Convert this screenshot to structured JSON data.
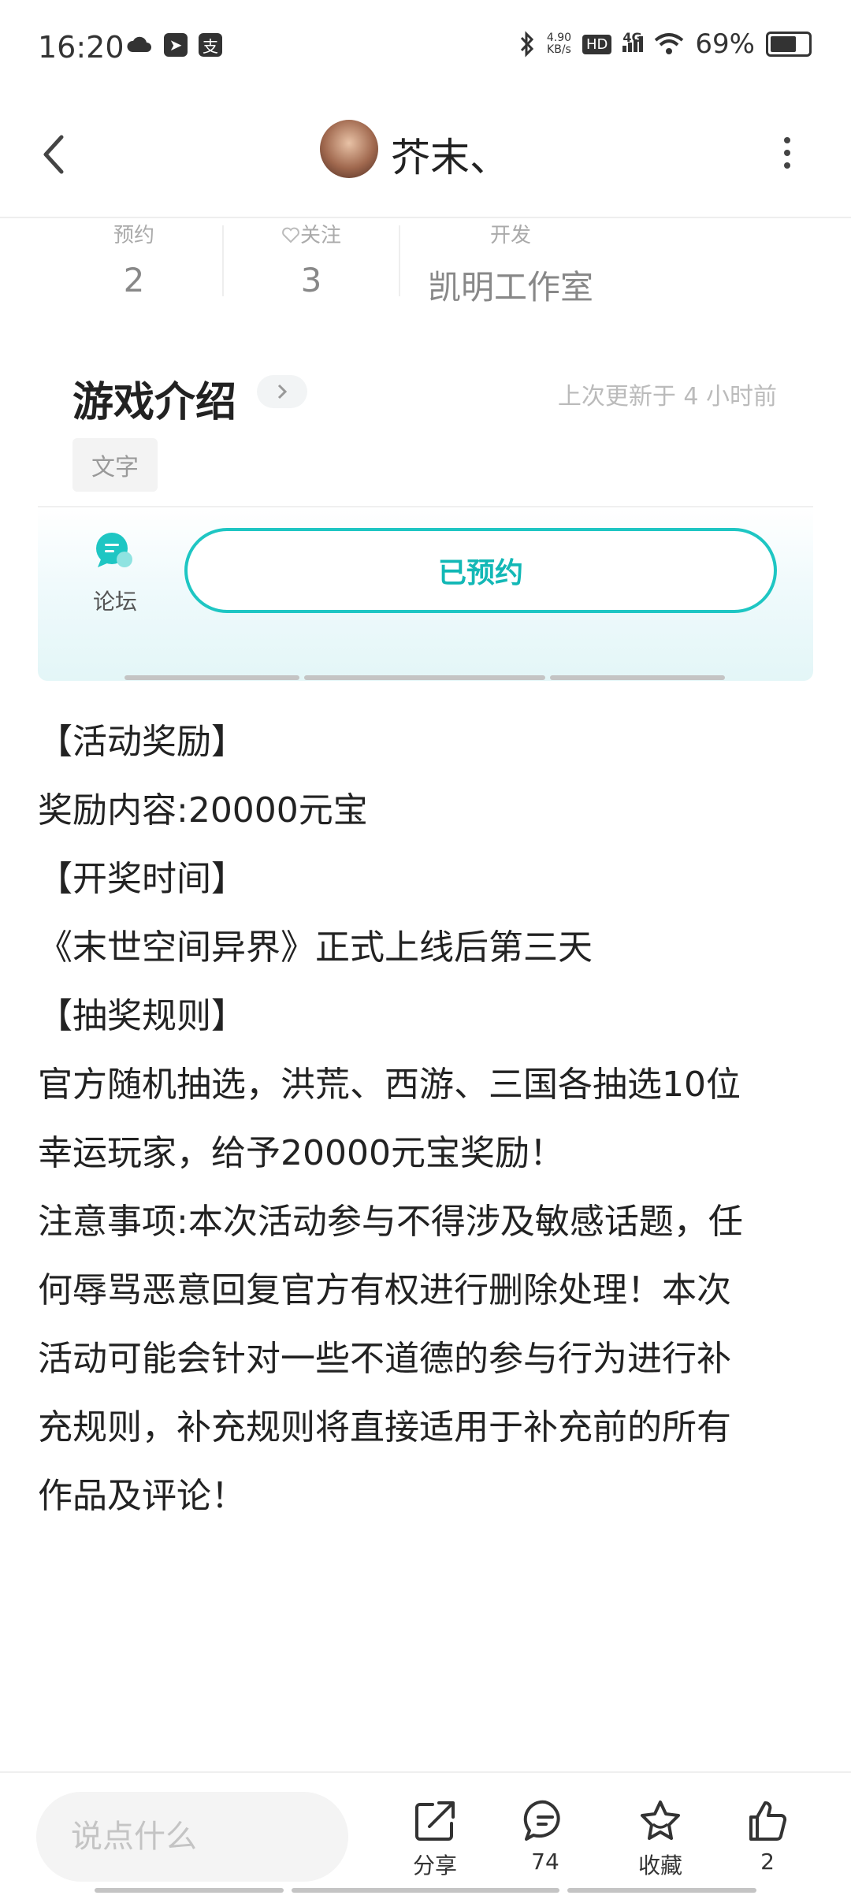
{
  "status_bar": {
    "time": "16:20",
    "net_speed_value": "4.90",
    "net_speed_unit": "KB/s",
    "hd": "HD",
    "network": "4G",
    "battery_text": "69%",
    "battery_level": 0.69
  },
  "header": {
    "nickname": "芥末、"
  },
  "stats": [
    {
      "label": "预约",
      "value": "2"
    },
    {
      "label": "关注",
      "value": "3"
    },
    {
      "label": "开发",
      "value": "凯明工作室"
    }
  ],
  "intro": {
    "title": "游戏介绍",
    "updated": "上次更新于 4 小时前",
    "tag": "文字"
  },
  "actions": {
    "forum_label": "论坛",
    "reserve_label": "已预约"
  },
  "article": [
    "【活动奖励】",
    "奖励内容:20000元宝",
    "",
    "【开奖时间】",
    "《末世空间异界》正式上线后第三天",
    "",
    "【抽奖规则】",
    "官方随机抽选，洪荒、西游、三国各抽选10位",
    "幸运玩家，给予20000元宝奖励！",
    "",
    "注意事项:本次活动参与不得涉及敏感话题，任",
    "何辱骂恶意回复官方有权进行删除处理！本次",
    "活动可能会针对一些不道德的参与行为进行补",
    "充规则，补充规则将直接适用于补充前的所有",
    "作品及评论！"
  ],
  "bottom_bar": {
    "comment_placeholder": "说点什么",
    "share_label": "分享",
    "comments_count": "74",
    "favorite_label": "收藏",
    "likes_count": "2"
  },
  "colors": {
    "accent": "#13b8b6",
    "text": "#222222",
    "muted": "#aaaaaa"
  }
}
